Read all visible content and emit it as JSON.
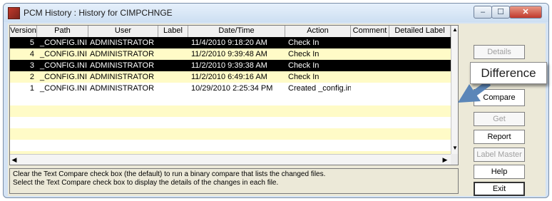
{
  "window": {
    "title": "PCM History  : History for CIMPCHNGE",
    "controls": {
      "minimize": "–",
      "maximize": "☐",
      "close": "✕"
    }
  },
  "table": {
    "columns": [
      "Version",
      "Path",
      "User",
      "Label",
      "Date/Time",
      "Action",
      "Comment",
      "Detailed Label"
    ],
    "rows": [
      {
        "version": "5",
        "path": "_CONFIG.INI",
        "user": "ADMINISTRATOR",
        "label": "",
        "datetime": "11/4/2010 9:18:20 AM",
        "action": "Check In",
        "comment": "",
        "detailed": "",
        "state": "selected"
      },
      {
        "version": "4",
        "path": "_CONFIG.INI",
        "user": "ADMINISTRATOR",
        "label": "",
        "datetime": "11/2/2010 9:39:48 AM",
        "action": "Check In",
        "comment": "",
        "detailed": "",
        "state": "yellow"
      },
      {
        "version": "3",
        "path": "_CONFIG.INI",
        "user": "ADMINISTRATOR",
        "label": "",
        "datetime": "11/2/2010 9:39:38 AM",
        "action": "Check In",
        "comment": "",
        "detailed": "",
        "state": "selected"
      },
      {
        "version": "2",
        "path": "_CONFIG.INI",
        "user": "ADMINISTRATOR",
        "label": "",
        "datetime": "11/2/2010 6:49:16 AM",
        "action": "Check In",
        "comment": "",
        "detailed": "",
        "state": "yellow"
      },
      {
        "version": "1",
        "path": "_CONFIG.INI",
        "user": "ADMINISTRATOR",
        "label": "",
        "datetime": "10/29/2010 2:25:34 PM",
        "action": "Created _config.ini",
        "comment": "",
        "detailed": "",
        "state": "white"
      }
    ],
    "scroll": {
      "up": "▲",
      "down": "▼",
      "left": "◀",
      "right": "▶"
    }
  },
  "info": {
    "line1": "Clear the Text Compare check box (the default) to run a binary compare that lists the changed files.",
    "line2": "Select the Text Compare check box to display the details of the changes in each file."
  },
  "buttons": {
    "details": "Details",
    "text_compare": "Compare",
    "get": "Get",
    "report": "Report",
    "label_master": "Label Master",
    "help": "Help",
    "exit": "Exit"
  },
  "tooltip": "Difference",
  "colors": {
    "selected": "#000000",
    "alt_row": "#fffbc7",
    "arrow": "#5b86b8"
  }
}
